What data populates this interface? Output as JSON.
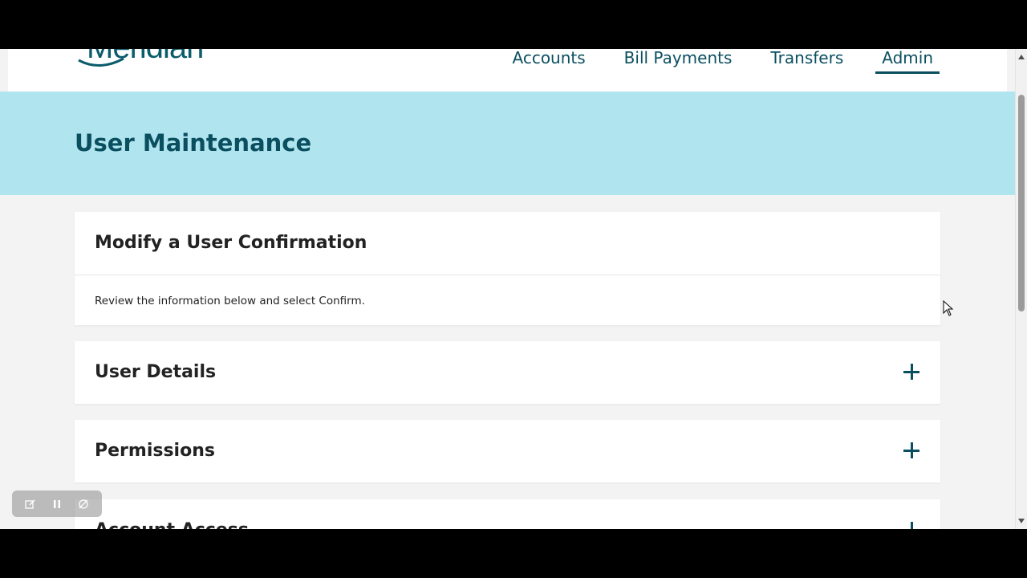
{
  "brand": {
    "logo_text": "Meridian"
  },
  "nav": {
    "items": [
      {
        "label": "Accounts"
      },
      {
        "label": "Bill Payments"
      },
      {
        "label": "Transfers"
      },
      {
        "label": "Admin",
        "active": true
      }
    ]
  },
  "banner": {
    "title": "User Maintenance"
  },
  "confirm_card": {
    "title": "Modify a User Confirmation",
    "description": "Review the information below and select Confirm."
  },
  "sections": [
    {
      "title": "User Details"
    },
    {
      "title": "Permissions"
    },
    {
      "title": "Account Access"
    }
  ],
  "colors": {
    "brand_teal": "#0a4f60",
    "banner_bg": "#b0e4ee",
    "page_bg": "#f3f3f3"
  },
  "recorder": {
    "icons": [
      "edit-icon",
      "pause-icon",
      "mic-off-icon"
    ]
  }
}
